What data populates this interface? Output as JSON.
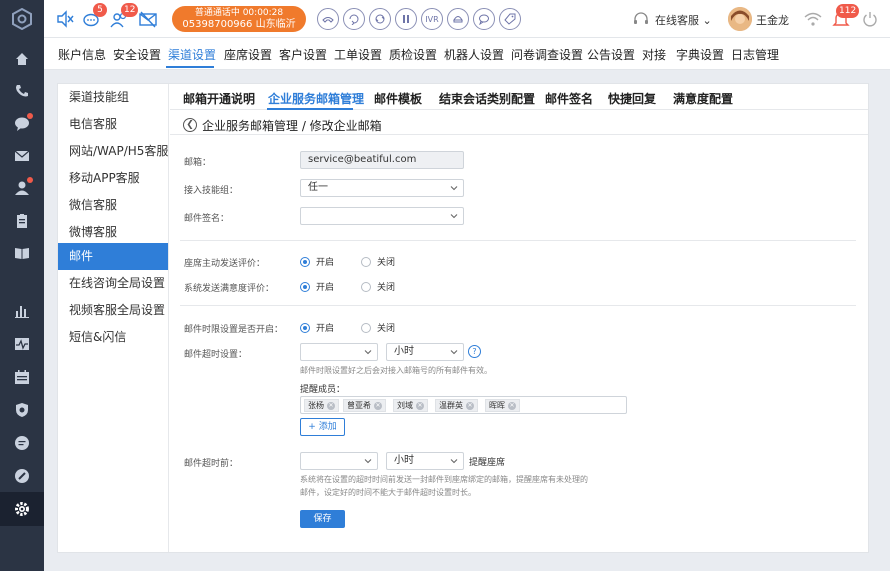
{
  "colors": {
    "accent": "#2f7ed8",
    "sidebar_bg": "#2b3444",
    "call_pill": "#f07a2c",
    "badge": "#f05a4a"
  },
  "topbar": {
    "badge_1": "5",
    "badge_2": "12",
    "call_status": "普通通话中  00:00:28",
    "call_number": "05398700966 山东临沂",
    "ctrl_ivr": "IVR",
    "agent_status": "在线客服",
    "user_name": "王金龙",
    "notify_count": "112"
  },
  "menu": {
    "items": [
      "账户信息",
      "安全设置",
      "渠道设置",
      "座席设置",
      "客户设置",
      "工单设置",
      "质检设置",
      "机器人设置",
      "问卷调查设置",
      "公告设置",
      "对接",
      "字典设置",
      "日志管理"
    ],
    "active_index": 2
  },
  "sub_sidebar": {
    "items": [
      "渠道技能组",
      "电信客服",
      "网站/WAP/H5客服",
      "移动APP客服",
      "微信客服",
      "微博客服",
      "邮件",
      "在线咨询全局设置",
      "视频客服全局设置",
      "短信&闪信"
    ],
    "active_index": 6
  },
  "tabs": {
    "items": [
      "邮箱开通说明",
      "企业服务邮箱管理",
      "邮件模板",
      "结束会话类别配置",
      "邮件签名",
      "快捷回复",
      "满意度配置"
    ],
    "active_index": 1
  },
  "breadcrumb": "企业服务邮箱管理 / 修改企业邮箱",
  "form": {
    "email_label": "邮箱：",
    "email_value": "service@beatiful.com",
    "skill_label": "接入技能组：",
    "skill_value": "任一",
    "signature_label": "邮件签名：",
    "signature_value": "",
    "agent_eval_label": "座席主动发送评价：",
    "system_eval_label": "系统发送满意度评价：",
    "opt_on": "开启",
    "opt_off": "关闭",
    "time_limit_label": "邮件时限设置是否开启：",
    "timeout_label": "邮件超时设置：",
    "timeout_value": "",
    "unit_value": "小时",
    "timeout_hint": "邮件时限设置好之后会对接入邮箱号的所有邮件有效。",
    "remind_members_label": "提醒成员：",
    "members": [
      "张杨",
      "曾亚希",
      "刘域",
      "温群英",
      "晖晖"
    ],
    "add_label": "+ 添加",
    "before_timeout_label": "邮件超时前：",
    "before_value": "",
    "before_unit": "小时",
    "remind_agent": "提醒座席",
    "before_hint_1": "系统将在设置的超时时间前发送一封邮件到座席绑定的邮箱，提醒座席有未处理的",
    "before_hint_2": "邮件，设定好的时间不能大于邮件超时设置时长。",
    "save_label": "保存"
  },
  "radios": {
    "agent_eval": "on",
    "system_eval": "on",
    "time_limit": "on"
  }
}
